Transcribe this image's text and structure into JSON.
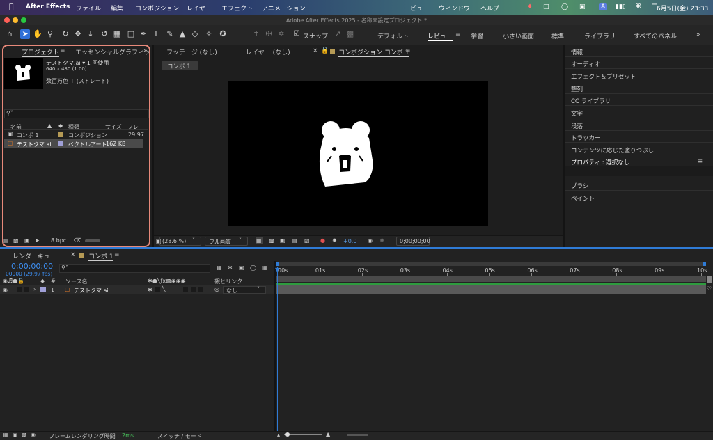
{
  "menubar": {
    "app_name": "After Effects",
    "items": [
      "ファイル",
      "編集",
      "コンポジション",
      "レイヤー",
      "エフェクト",
      "アニメーション",
      "ビュー",
      "ウィンドウ",
      "ヘルプ"
    ],
    "date_time": "6月5日(金)  23:33",
    "input_indicator": "A"
  },
  "titlebar": {
    "title": "Adobe After Effects 2025 - 名称未設定プロジェクト *"
  },
  "toolbar": {
    "snap_label": "スナップ",
    "workspaces": [
      "デフォルト",
      "レビュー",
      "学習",
      "小さい画面",
      "標準",
      "ライブラリ",
      "すべてのパネル"
    ],
    "active_workspace": "レビュー"
  },
  "project_panel": {
    "tab_project": "プロジェクト",
    "tab_essential": "エッセンシャルグラフィッ",
    "preview_name": "テストクマ.ai ▾ 1 回使用",
    "preview_size": "640 x 480 (1.00)",
    "preview_color": "数百万色 + (ストレート)",
    "search_placeholder": "",
    "columns": {
      "name": "名前",
      "type": "種類",
      "size": "サイズ",
      "frame": "フレ"
    },
    "items": [
      {
        "name": "コンポ 1",
        "type": "コンポジション",
        "size": "",
        "frame": "29.97",
        "label_color": "#b59a55"
      },
      {
        "name": "テストクマ.ai",
        "type": "ベクトルアート",
        "size": "162 KB",
        "frame": "",
        "label_color": "#9f9fd6"
      }
    ],
    "bpc": "8 bpc"
  },
  "viewer": {
    "tab_footage": "フッテージ (なし)",
    "tab_layer": "レイヤー (なし)",
    "tab_comp": "コンポジション コンポ 1",
    "comp_chip": "コンポ 1",
    "zoom": "(28.6 %)",
    "resolution": "フル画質",
    "exposure": "+0.0",
    "timecode": "0;00;00;00"
  },
  "right_panel": {
    "items": [
      "情報",
      "オーディオ",
      "エフェクト＆プリセット",
      "整列",
      "CC ライブラリ",
      "文字",
      "段落",
      "トラッカー",
      "コンテンツに応じた塗りつぶし"
    ],
    "properties_title": "プロパティ : 選択なし",
    "lower_items": [
      "ブラシ",
      "ペイント"
    ]
  },
  "timeline": {
    "tab_render": "レンダーキュー",
    "tab_comp": "コンポ 1",
    "timecode": "0;00;00;00",
    "fps_info": "00000 (29.97 fps)",
    "col_source": "ソース名",
    "col_parent": "親とリンク",
    "layer": {
      "index": "1",
      "name": "テストクマ.ai",
      "parent": "なし"
    },
    "ticks": [
      "00s",
      "01s",
      "02s",
      "03s",
      "04s",
      "05s",
      "06s",
      "07s",
      "08s",
      "09s",
      "10s"
    ],
    "footer_render_label": "フレームレンダリング時間 :",
    "footer_render_value": "2ms",
    "footer_switch": "スイッチ / モード"
  }
}
